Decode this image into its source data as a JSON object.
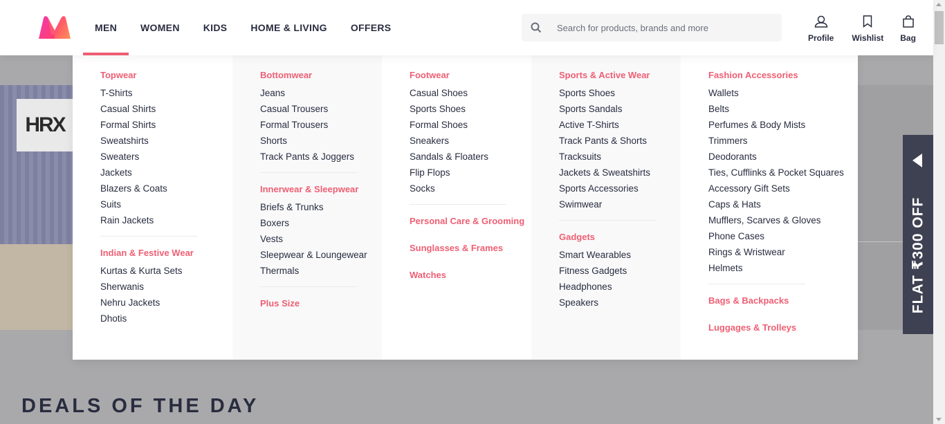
{
  "header": {
    "nav": [
      "MEN",
      "WOMEN",
      "KIDS",
      "HOME & LIVING",
      "OFFERS"
    ],
    "search_placeholder": "Search for products, brands and more",
    "actions": [
      "Profile",
      "Wishlist",
      "Bag"
    ]
  },
  "banner": {
    "brand": "HRX"
  },
  "promo": {
    "text": "FLAT ₹300 OFF"
  },
  "deals_title": "DEALS OF THE DAY",
  "menu": {
    "col1": {
      "g1": {
        "title": "Topwear",
        "items": [
          "T-Shirts",
          "Casual Shirts",
          "Formal Shirts",
          "Sweatshirts",
          "Sweaters",
          "Jackets",
          "Blazers & Coats",
          "Suits",
          "Rain Jackets"
        ]
      },
      "g2": {
        "title": "Indian & Festive Wear",
        "items": [
          "Kurtas & Kurta Sets",
          "Sherwanis",
          "Nehru Jackets",
          "Dhotis"
        ]
      }
    },
    "col2": {
      "g1": {
        "title": "Bottomwear",
        "items": [
          "Jeans",
          "Casual Trousers",
          "Formal Trousers",
          "Shorts",
          "Track Pants & Joggers"
        ]
      },
      "g2": {
        "title": "Innerwear & Sleepwear",
        "items": [
          "Briefs & Trunks",
          "Boxers",
          "Vests",
          "Sleepwear & Loungewear",
          "Thermals"
        ]
      },
      "g3": {
        "title": "Plus Size"
      }
    },
    "col3": {
      "g1": {
        "title": "Footwear",
        "items": [
          "Casual Shoes",
          "Sports Shoes",
          "Formal Shoes",
          "Sneakers",
          "Sandals & Floaters",
          "Flip Flops",
          "Socks"
        ]
      },
      "g2": {
        "title": "Personal Care & Grooming"
      },
      "g3": {
        "title": "Sunglasses & Frames"
      },
      "g4": {
        "title": "Watches"
      }
    },
    "col4": {
      "g1": {
        "title": "Sports & Active Wear",
        "items": [
          "Sports Shoes",
          "Sports Sandals",
          "Active T-Shirts",
          "Track Pants & Shorts",
          "Tracksuits",
          "Jackets & Sweatshirts",
          "Sports Accessories",
          "Swimwear"
        ]
      },
      "g2": {
        "title": "Gadgets",
        "items": [
          "Smart Wearables",
          "Fitness Gadgets",
          "Headphones",
          "Speakers"
        ]
      }
    },
    "col5": {
      "g1": {
        "title": "Fashion Accessories",
        "items": [
          "Wallets",
          "Belts",
          "Perfumes & Body Mists",
          "Trimmers",
          "Deodorants",
          "Ties, Cufflinks & Pocket Squares",
          "Accessory Gift Sets",
          "Caps & Hats",
          "Mufflers, Scarves & Gloves",
          "Phone Cases",
          "Rings & Wristwear",
          "Helmets"
        ]
      },
      "g2": {
        "title": "Bags & Backpacks"
      },
      "g3": {
        "title": "Luggages & Trolleys"
      }
    }
  }
}
